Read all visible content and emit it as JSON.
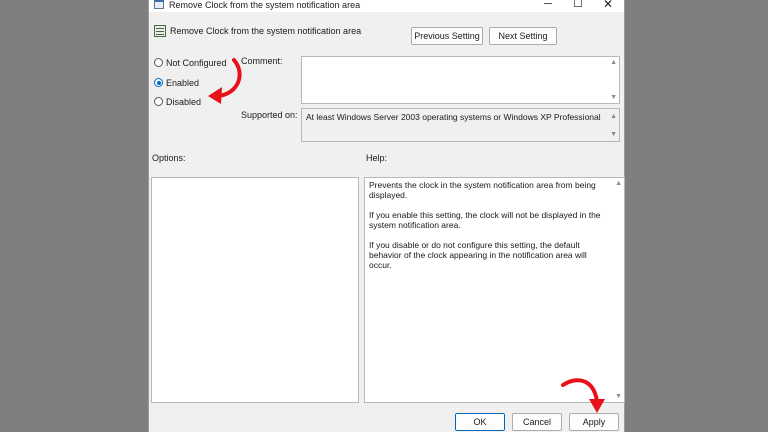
{
  "window": {
    "title": "Remove Clock from the system notification area",
    "minimize_glyph": "─",
    "maximize_glyph": "☐",
    "close_glyph": "✕"
  },
  "header": {
    "setting_title": "Remove Clock from the system notification area",
    "previous_label": "Previous Setting",
    "next_label": "Next Setting"
  },
  "state": {
    "options": [
      "Not Configured",
      "Enabled",
      "Disabled"
    ],
    "selected": "Enabled"
  },
  "comment": {
    "label": "Comment:",
    "value": ""
  },
  "supported": {
    "label": "Supported on:",
    "value": "At least Windows Server 2003 operating systems or Windows XP Professional"
  },
  "options_pane": {
    "label": "Options:"
  },
  "help": {
    "label": "Help:",
    "paragraphs": [
      "Prevents the clock in the system notification area from being displayed.",
      "If you enable this setting, the clock will not be displayed in the system notification area.",
      "If you disable or do not configure this setting, the default behavior of the clock appearing in the notification area will occur."
    ]
  },
  "footer": {
    "ok_label": "OK",
    "cancel_label": "Cancel",
    "apply_label": "Apply"
  },
  "annotation": {
    "arrow_color": "#e8101a"
  },
  "colors": {
    "accent": "#0067c0",
    "backdrop": "#7f7f7f",
    "dialog": "#f0f0f0"
  }
}
